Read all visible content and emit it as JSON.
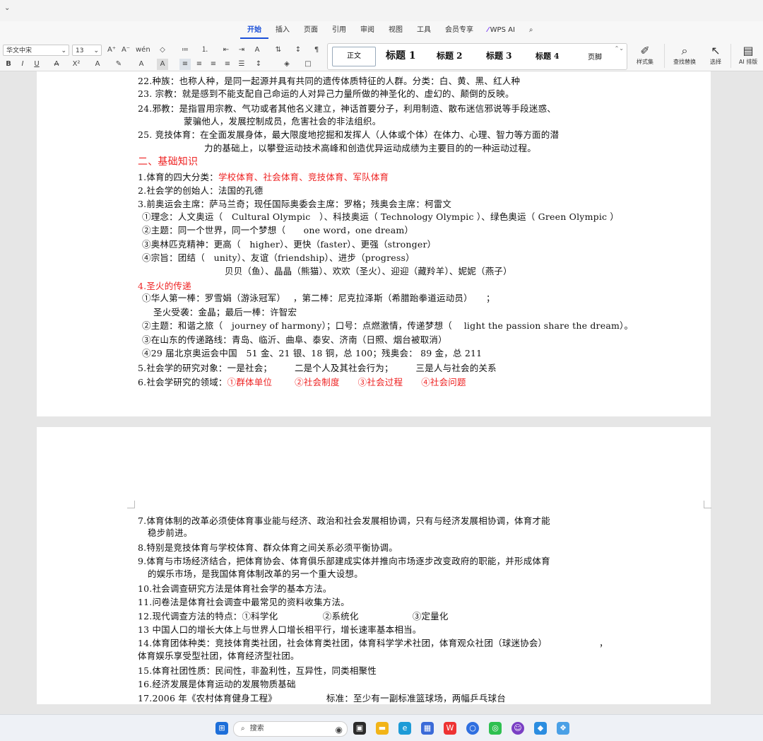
{
  "ribbon": {
    "tabs": [
      "开始",
      "插入",
      "页面",
      "引用",
      "审阅",
      "视图",
      "工具",
      "会员专享",
      "WPS AI"
    ],
    "active_tab": "开始",
    "font_name": "华文中宋",
    "font_size": "13",
    "styles": [
      "正文",
      "标题 1",
      "标题 2",
      "标题 3",
      "标题 4",
      "页脚"
    ],
    "tools": {
      "styleset": "样式集",
      "find_replace": "查找替换",
      "select": "选择",
      "ai_layout": "AI 排版"
    },
    "colors": {
      "font_color": "#e22222",
      "highlight": "#f0c419"
    }
  },
  "page1": {
    "lines": [
      "22.种族：也称人种，是同一起源并具有共同的遗传体质特征的人群。分类：白、黄、黑、红人种",
      "23. 宗教：就是感到不能支配自己命运的人对异己力量所做的神圣化的、虚幻的、颠倒的反映。",
      "24.邪教：是指冒用宗教、气功或者其他名义建立，神话首要分子，利用制造、散布迷信邪说等手段迷惑、",
      "蒙骗他人，发展控制成员，危害社会的非法组织。",
      "25. 竞技体育：在全面发展身体，最大限度地挖掘和发挥人（人体或个体）在体力、心理、智力等方面的潜",
      "力的基础上，以攀登运动技术高峰和创造优异运动成绩为主要目的的一种运动过程。"
    ],
    "section_heading": "二、基础知识",
    "item1_prefix": "1.体育的四大分类：",
    "item1_red": "学校体育、社会体育、竞技体育、军队体育",
    "item2": "2.社会学的创始人：法国的孔德",
    "item3": "3.前奥运会主席：萨马兰奇；现任国际奥委会主席：罗格；残奥会主席：柯雷文",
    "olympic_lines": [
      "①理念：人文奥运（　Cultural Olympic　）、科技奥运（ Technology Olympic ）、绿色奥运（ Green Olympic ）",
      "②主题：同一个世界，同一个梦想（　　one word，one dream）",
      "③奥林匹克精神：更高（　higher）、更快（faster）、更强（stronger）",
      "④宗旨：团结（　unity）、友谊（friendship）、进步（progress）",
      "贝贝（鱼）、晶晶（熊猫）、欢欢（圣火）、迎迎（藏羚羊）、妮妮（燕子）"
    ],
    "torch_heading": "4.圣火的传递",
    "torch_lines": [
      "①华人第一棒：罗雪娟（游泳冠军）　 ，第二棒：尼克拉泽斯（希腊跆拳道运动员）　　；",
      "圣火受袭：金晶；最后一棒：许智宏",
      "②主题：和谐之旅（　journey of harmony）；口号：点燃激情，传递梦想（　 light the passion share the dream）。",
      "③在山东的传递路线：青岛、临沂、曲阜、泰安、济南（日照、烟台被取消）",
      "④29 届北京奥运会中国　51 金、21 银、18 铜，总 100；残奥会： 89 金，总 211"
    ],
    "item5": "5.社会学的研究对象：一是社会；　　　二是个人及其社会行为；　　　三是人与社会的关系",
    "item6_prefix": "6.社会学研究的领域：",
    "item6_red": [
      "①群体单位",
      "②社会制度",
      "③社会过程",
      "④社会问题"
    ]
  },
  "page2": {
    "lines": [
      "7.体育体制的改革必须使体育事业能与经济、政治和社会发展相协调，只有与经济发展相协调，体育才能",
      "稳步前进。",
      "8.特别是竞技体育与学校体育、群众体育之间关系必须平衡协调。",
      "9.体育与市场经济结合，把体育协会、体育俱乐部建成实体并推向市场逐步改变政府的职能，并形成体育",
      "的娱乐市场，是我国体育体制改革的另一个重大设想。",
      "10.社会调查研究方法是体育社会学的基本方法。",
      "11.问卷法是体育社会调查中最常见的资料收集方法。",
      "12.现代调查方法的特点：①科学化　　　　　②系统化　　　　　　③定量化",
      "13 中国人口的增长大体上与世界人口增长相平行，增长速率基本相当。",
      "14.体育团体种类：竞技体育类社团，社会体育类社团，体育科学学术社团，体育观众社团（球迷协会）",
      "体育娱乐享受型社团，体育经济型社团。",
      "15.体育社团性质：民间性，非盈利性，互异性，同类相聚性",
      "16.经济发展是体育运动的发展物质基础",
      "17.2006 年《农村体育健身工程》　　　　　　标准：至少有一副标准篮球场，两幅乒乓球台"
    ],
    "line14_tail": "，"
  },
  "taskbar": {
    "search_placeholder": "搜索"
  }
}
